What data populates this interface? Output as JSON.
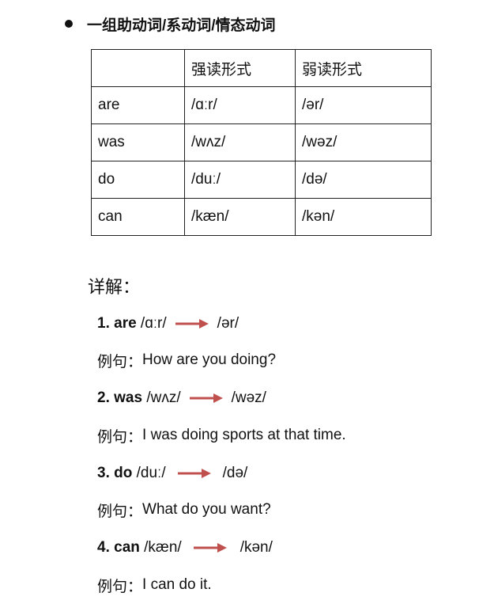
{
  "heading": "一组助动词/系动词/情态动词",
  "table": {
    "header": [
      "",
      "强读形式",
      "弱读形式"
    ],
    "rows": [
      [
        "are",
        "/ɑːr/",
        "/ər/"
      ],
      [
        "was",
        "/wʌz/",
        "/wəz/"
      ],
      [
        "do",
        "/duː/",
        "/də/"
      ],
      [
        "can",
        "/kæn/",
        "/kən/"
      ]
    ]
  },
  "details_title": "详解：",
  "details": [
    {
      "num_word": "1. are",
      "strong": " /ɑːr/",
      "weak": "/ər/",
      "example_label": "例句：",
      "example": "How are you doing?"
    },
    {
      "num_word": "2. was",
      "strong": " /wʌz/",
      "weak": "/wəz/",
      "example_label": "例句：",
      "example": "I was doing sports at that time."
    },
    {
      "num_word": "3. do",
      "strong": " /duː/",
      "weak": "/də/",
      "example_label": "例句：",
      "example": "What do you want?"
    },
    {
      "num_word": "4. can",
      "strong": " /kæn/",
      "weak": "/kən/",
      "example_label": "例句：",
      "example": "I can do it."
    }
  ],
  "colors": {
    "arrow": "#c0504d",
    "text": "#111111"
  },
  "icons": {
    "bullet": "bullet-dot-icon",
    "arrow": "right-arrow-icon"
  }
}
